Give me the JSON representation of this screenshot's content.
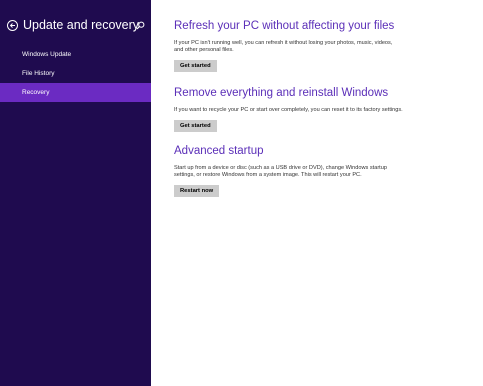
{
  "sidebar": {
    "title": "Update and recovery",
    "back_icon": "back-arrow-icon",
    "search_icon": "search-icon",
    "items": [
      {
        "label": "Windows Update"
      },
      {
        "label": "File History"
      },
      {
        "label": "Recovery",
        "selected": true
      }
    ],
    "background_color": "#1f0b4f",
    "selected_color": "#6b2bc2"
  },
  "main": {
    "accent_color": "#5b2fb8",
    "sections": [
      {
        "title": "Refresh your PC without affecting your files",
        "description": "If your PC isn't running well, you can refresh it without losing your photos, music, videos, and other personal files.",
        "button_label": "Get started"
      },
      {
        "title": "Remove everything and reinstall Windows",
        "description": "If you want to recycle your PC or start over completely, you can reset it to its factory settings.",
        "button_label": "Get started"
      },
      {
        "title": "Advanced startup",
        "description": "Start up from a device or disc (such as a USB drive or DVD), change Windows startup settings, or restore Windows from a system image. This will restart your PC.",
        "button_label": "Restart now"
      }
    ]
  }
}
